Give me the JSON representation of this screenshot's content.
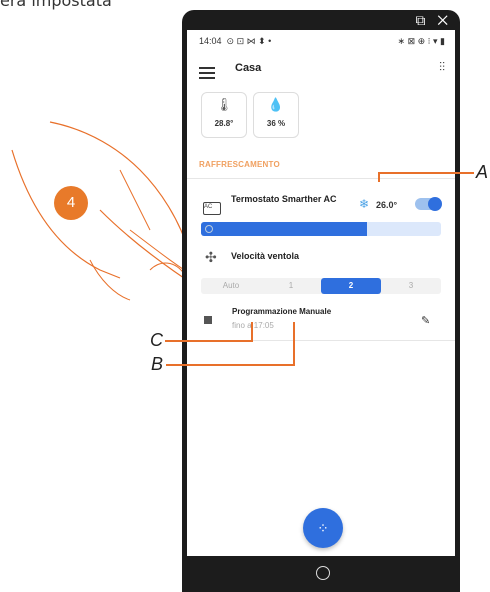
{
  "caption": "era impostata",
  "statusbar": {
    "time": "14:04",
    "left_icons": "⊙ ⊡ ⋈ ⬍ •",
    "right_icons": "∗ ⊠ ⊕ ⁝ ▾ ▮"
  },
  "frame_icons": "⧉ ✕",
  "appbar": {
    "title": "Casa"
  },
  "sensors": [
    {
      "icon": "thermometer-icon",
      "value": "28.8°"
    },
    {
      "icon": "drop-icon",
      "value": "36 %"
    }
  ],
  "section": "RAFFRESCAMENTO",
  "thermostat": {
    "name": "Termostato Smarther AC",
    "temperature": "26.0°",
    "enabled": true,
    "ac_label": "AC"
  },
  "slider_level": 0.69,
  "fan": {
    "label": "Velocità ventola",
    "options": [
      "Auto",
      "1",
      "2",
      "3"
    ],
    "selected": "2"
  },
  "schedule": {
    "title": "Programmazione Manuale",
    "subtitle": "fino a 17:05"
  },
  "badge": "4",
  "callouts": {
    "a": "A",
    "b": "B",
    "c": "C"
  },
  "colors": {
    "accent": "#2f6fde",
    "orange": "#e8702a",
    "section": "#f0a060"
  }
}
